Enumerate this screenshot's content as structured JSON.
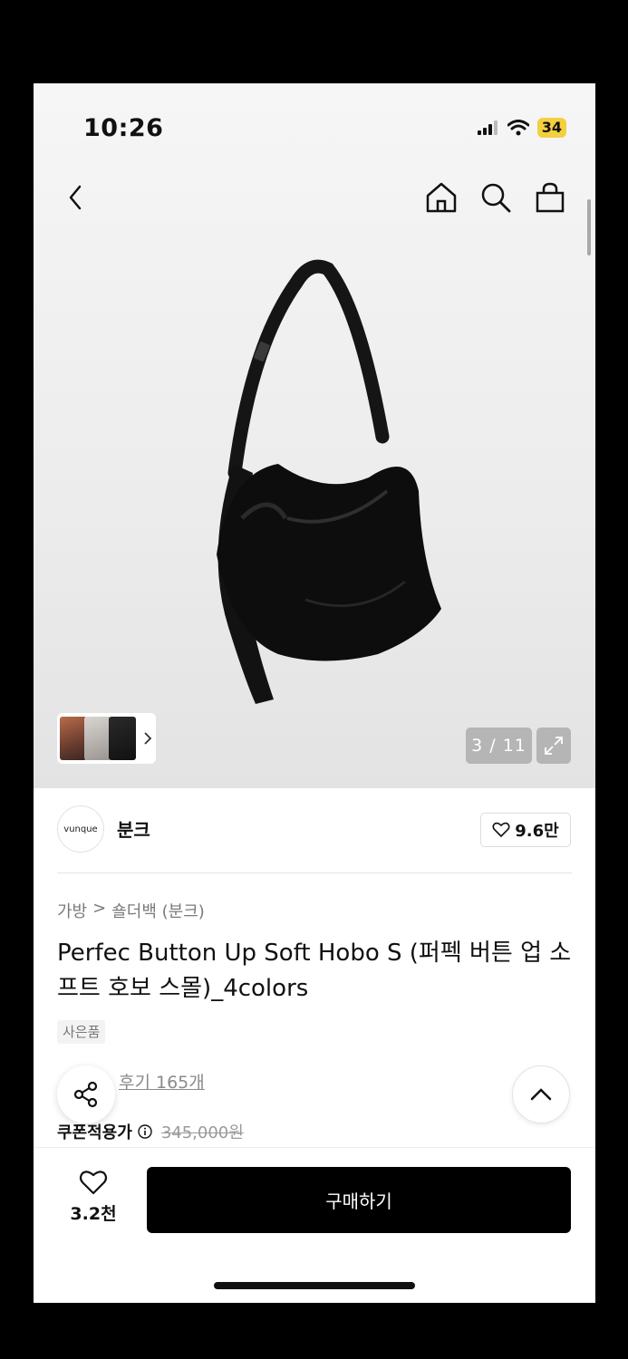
{
  "status_bar": {
    "time": "10:26",
    "battery": "34"
  },
  "gallery": {
    "counter": "3 / 11"
  },
  "brand": {
    "logo_text": "vunque",
    "name": "분크",
    "like_count": "9.6만"
  },
  "breadcrumb": {
    "category": "가방",
    "separator": ">",
    "subcategory": "숄더백 (분크)"
  },
  "product": {
    "title": "Perfec Button Up Soft Hobo S (퍼펙 버튼 업 소프트 호보 스몰)_4colors",
    "gift_badge": "사은품",
    "review_link": "후기 165개",
    "coupon_label": "쿠폰적용가",
    "original_price": "345,000원"
  },
  "bottom_bar": {
    "wish_count": "3.2천",
    "buy_label": "구매하기"
  },
  "colors": {
    "buy_button": "#000000",
    "battery": "#f4d03f"
  }
}
